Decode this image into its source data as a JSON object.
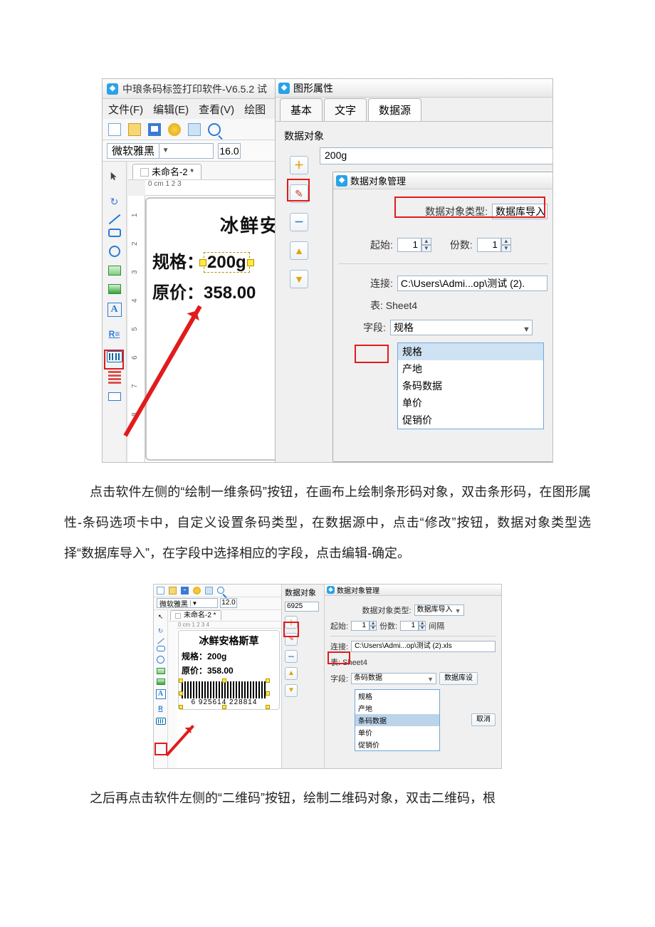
{
  "shot1": {
    "app_title": "中琅条码标签打印软件-V6.5.2 试",
    "menu": {
      "file": "文件(F)",
      "edit": "编辑(E)",
      "view": "查看(V)",
      "draw": "绘图"
    },
    "font_name": "微软雅黑",
    "font_size": "16.0",
    "doc_tab": "未命名-2 *",
    "ruler_h": "0 cm 1      2      3",
    "canvas": {
      "title": "冰鲜安格斯",
      "spec_label": "规格：",
      "spec_value": "200g",
      "price_label": "原价：",
      "price_value": "358.00"
    },
    "dialog": {
      "title": "图形属性",
      "tabs": {
        "basic": "基本",
        "text": "文字",
        "datasource": "数据源"
      },
      "ds_header": "数据对象",
      "ds_value": "200g",
      "child_title": "数据对象管理",
      "type_label": "数据对象类型:",
      "type_value": "数据库导入",
      "start_label": "起始:",
      "start_value": "1",
      "copies_label": "份数:",
      "copies_value": "1",
      "conn_label": "连接:",
      "conn_value": "C:\\Users\\Admi...op\\测试 (2).",
      "table_label": "表: Sheet4",
      "field_label": "字段:",
      "field_value": "规格",
      "field_options": [
        "规格",
        "产地",
        "条码数据",
        "单价",
        "促销价"
      ]
    }
  },
  "para1": "点击软件左侧的“绘制一维条码”按钮，在画布上绘制条形码对象，双击条形码，在图形属性-条码选项卡中，自定义设置条码类型，在数据源中，点击“修改”按钮，数据对象类型选择“数据库导入”，在字段中选择相应的字段，点击编辑-确定。",
  "shot2": {
    "font_name": "微软雅黑",
    "font_size": "12.0",
    "doc_tab": "未命名-2 *",
    "ruler_h": "0 cm 1   2   3   4",
    "canvas": {
      "title": "冰鲜安格斯草",
      "spec": "规格：200g",
      "price": "原价：358.00",
      "barcode_text": "6  925614  228814"
    },
    "mid": {
      "header": "数据对象",
      "value": "6925"
    },
    "right": {
      "title": "数据对象管理",
      "type_label": "数据对象类型:",
      "type_value": "数据库导入",
      "start_label": "起始:",
      "start_value": "1",
      "copies_label": "份数:",
      "copies_value": "1",
      "gap_label": "间隔",
      "conn_label": "连接:",
      "conn_value": "C:\\Users\\Admi...op\\测试 (2).xls",
      "table_label": "表: Sheet4",
      "field_label": "字段:",
      "field_value": "条码数据",
      "field_options": [
        "规格",
        "产地",
        "条码数据",
        "单价",
        "促销价"
      ],
      "db_btn": "数据库设",
      "cancel_btn": "取消"
    }
  },
  "para2": "之后再点击软件左侧的“二维码”按钮，绘制二维码对象，双击二维码，根"
}
